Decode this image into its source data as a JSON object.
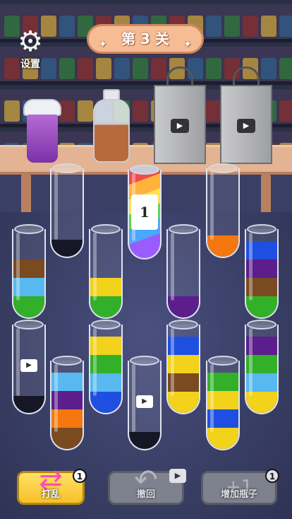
{
  "header": {
    "settings_label": "设置",
    "level_title": "第 3 关"
  },
  "table_items": {
    "bottle_label": "1"
  },
  "colors": {
    "brown": "#7a4a21",
    "skyblue": "#57b9ef",
    "green": "#32b02a",
    "yellow": "#f2d21a",
    "purple": "#5b1e8c",
    "orange": "#f4780f",
    "blue": "#1f4fe0"
  },
  "tubes": [
    {
      "id": "tube-r1-1",
      "layers": []
    },
    {
      "id": "tube-r1-special",
      "special_label": "1"
    },
    {
      "id": "tube-r1-3",
      "layers": [
        "orange"
      ]
    },
    {
      "id": "tube-r2-1",
      "layers": [
        "green",
        "skyblue",
        "brown"
      ]
    },
    {
      "id": "tube-r2-2",
      "layers": [
        "green",
        "yellow"
      ]
    },
    {
      "id": "tube-r2-3",
      "layers": [
        "purple"
      ]
    },
    {
      "id": "tube-r2-4",
      "layers": [
        "green",
        "brown",
        "purple",
        "blue"
      ]
    },
    {
      "id": "tube-r3-1",
      "layers": [],
      "locked_video": true
    },
    {
      "id": "tube-r3-2",
      "layers": [
        "blue",
        "skyblue",
        "green",
        "yellow"
      ]
    },
    {
      "id": "tube-r3-3",
      "layers": [
        "yellow",
        "brown",
        "yellow",
        "blue"
      ]
    },
    {
      "id": "tube-r3-4",
      "layers": [
        "yellow",
        "blue",
        "yellow",
        "green"
      ]
    },
    {
      "id": "tube-r3-5",
      "layers": [
        "yellow",
        "skyblue",
        "green",
        "purple"
      ]
    },
    {
      "id": "tube-r3-6",
      "layers": [
        "brown",
        "orange",
        "purple",
        "skyblue"
      ]
    },
    {
      "id": "tube-r3-7",
      "layers": [],
      "locked_video": true
    }
  ],
  "buttons": {
    "shuffle_label": "打乱",
    "shuffle_count": "1",
    "undo_label": "撤回",
    "add_label": "增加瓶子",
    "add_count": "1",
    "add_icon_text": "+1"
  }
}
